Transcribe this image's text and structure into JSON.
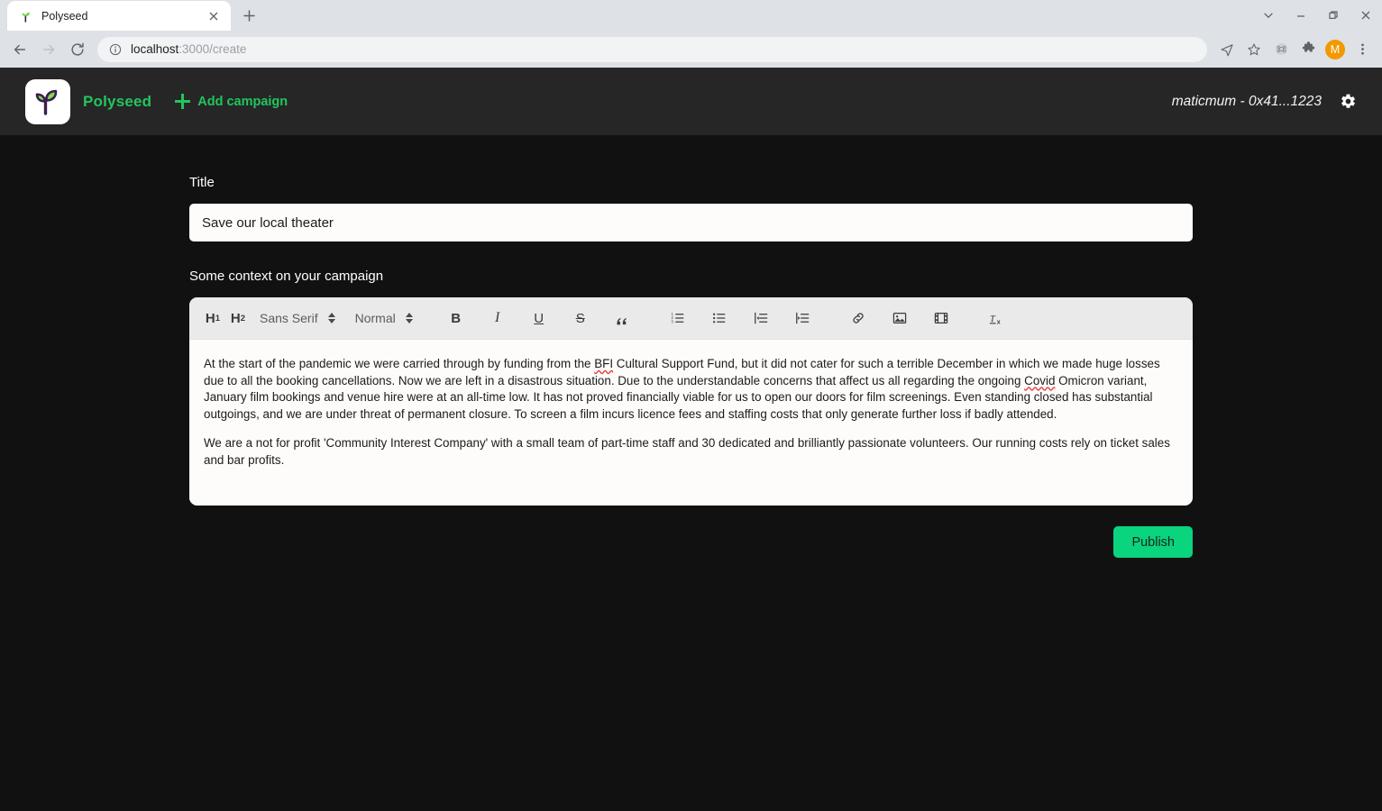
{
  "browser": {
    "tab": {
      "title": "Polyseed",
      "favicon_icon": "seedling-icon",
      "close_icon": "close-icon"
    },
    "new_tab_icon": "plus-icon",
    "window_controls": {
      "tab_search_icon": "chevron-down-icon",
      "minimize_icon": "minimize-icon",
      "maximize_icon": "maximize-icon",
      "close_icon": "close-icon"
    },
    "nav": {
      "back_icon": "arrow-left-icon",
      "forward_icon": "arrow-right-icon",
      "reload_icon": "reload-icon"
    },
    "omnibox": {
      "site_info_icon": "info-circle-icon",
      "host": "localhost",
      "path": ":3000/create",
      "full_url": "localhost:3000/create"
    },
    "toolbar_icons": [
      {
        "name": "send-share-icon"
      },
      {
        "name": "bookmark-star-icon"
      },
      {
        "name": "command-circle-icon"
      },
      {
        "name": "extensions-puzzle-icon"
      }
    ],
    "profile": {
      "initial": "M",
      "color": "#f29900"
    },
    "menu_icon": "three-dot-menu-icon"
  },
  "header": {
    "logo_icon": "seedling-logo-icon",
    "brand": "Polyseed",
    "add_campaign": {
      "label": "Add campaign",
      "icon": "plus-icon"
    },
    "account": "maticmum - 0x41...1223",
    "settings_icon": "gear-icon"
  },
  "form": {
    "title_label": "Title",
    "title_value": "Save our local theater",
    "title_placeholder": "Title",
    "context_label": "Some context on your campaign",
    "publish_label": "Publish"
  },
  "editor": {
    "toolbar": {
      "h1": "H",
      "h1_sub": "1",
      "h2": "H",
      "h2_sub": "2",
      "font_family": "Sans Serif",
      "font_size": "Normal",
      "bold": "B",
      "italic": "I",
      "underline": "U",
      "strike": "S",
      "blockquote": "”",
      "icons": [
        "ordered-list-icon",
        "bullet-list-icon",
        "outdent-icon",
        "indent-icon",
        "link-icon",
        "image-icon",
        "video-icon",
        "clear-format-icon"
      ]
    },
    "paragraphs": [
      {
        "parts": [
          {
            "text": "At the start of the pandemic we were carried through by funding from the "
          },
          {
            "text": "BFI",
            "spellcheck_error": true
          },
          {
            "text": " Cultural Support Fund, but it did not cater for such a terrible December in which we made huge losses due to all the booking cancellations. Now we are left in a disastrous situation. Due to the understandable concerns that affect us all regarding the ongoing "
          },
          {
            "text": "Covid",
            "spellcheck_error": true
          },
          {
            "text": " Omicron variant, January film bookings and venue hire were at an all-time low. It has not proved financially viable for us to open our doors for film screenings. Even standing closed has substantial outgoings, and we are under threat of permanent closure. To screen a film incurs licence fees and staffing costs that only generate further loss if badly attended."
          }
        ]
      },
      {
        "parts": [
          {
            "text": "We are a not for profit 'Community Interest Company' with a small team of part-time staff and 30 dedicated and brilliantly passionate volunteers. Our running costs rely on ticket sales and bar profits."
          }
        ]
      }
    ]
  },
  "colors": {
    "accent_green": "#22c55e",
    "publish_green": "#0ad47e",
    "app_background": "#111111",
    "header_background": "#262626",
    "editor_background": "#fdfcfa",
    "spell_error": "#e53935"
  }
}
